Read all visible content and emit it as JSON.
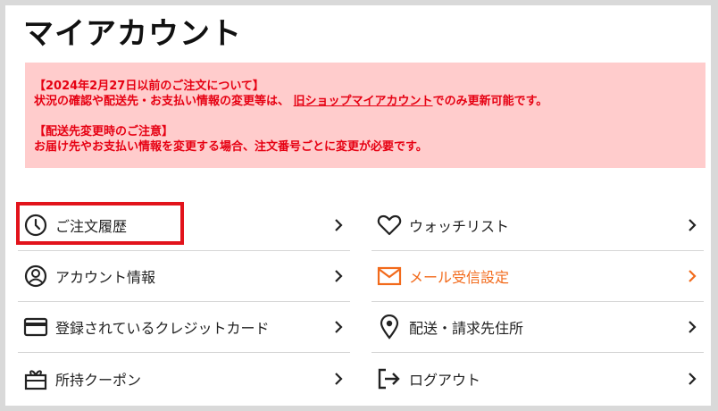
{
  "page": {
    "title": "マイアカウント"
  },
  "notice": {
    "heading1": "【2024年2月27日以前のご注文について】",
    "line1_prefix": "状況の確認や配送先・お支払い情報の変更等は、",
    "line1_link": "旧ショップマイアカウント",
    "line1_suffix": "でのみ更新可能です。",
    "heading2": "【配送先変更時のご注意】",
    "line2": "お届け先やお支払い情報を変更する場合、注文番号ごとに変更が必要です。",
    "text_color": "#e60012",
    "background": "#ffcccc"
  },
  "menu": {
    "left": [
      {
        "label": "ご注文履歴",
        "icon": "clock-icon"
      },
      {
        "label": "アカウント情報",
        "icon": "user-circle-icon"
      },
      {
        "label": "登録されているクレジットカード",
        "icon": "credit-card-icon"
      },
      {
        "label": "所持クーポン",
        "icon": "gift-coupon-icon"
      }
    ],
    "right": [
      {
        "label": "ウォッチリスト",
        "icon": "heart-icon"
      },
      {
        "label": "メール受信設定",
        "icon": "mail-icon",
        "accent_color": "#f26a1b"
      },
      {
        "label": "配送・請求先住所",
        "icon": "location-pin-icon"
      },
      {
        "label": "ログアウト",
        "icon": "logout-icon"
      }
    ]
  },
  "highlight": {
    "target": "ご注文履歴",
    "color": "#e2131b"
  }
}
